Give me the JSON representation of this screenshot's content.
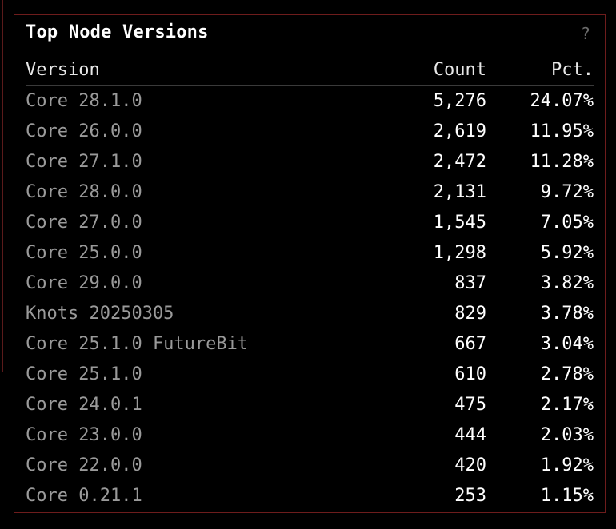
{
  "panel": {
    "title": "Top Node Versions",
    "help_label": "?",
    "help_icon": "question-icon",
    "border_color": "#6e1c1c"
  },
  "table": {
    "headers": {
      "version": "Version",
      "count": "Count",
      "pct": "Pct."
    },
    "rows": [
      {
        "version": "Core 28.1.0",
        "count": "5,276",
        "pct": "24.07%"
      },
      {
        "version": "Core 26.0.0",
        "count": "2,619",
        "pct": "11.95%"
      },
      {
        "version": "Core 27.1.0",
        "count": "2,472",
        "pct": "11.28%"
      },
      {
        "version": "Core 28.0.0",
        "count": "2,131",
        "pct": "9.72%"
      },
      {
        "version": "Core 27.0.0",
        "count": "1,545",
        "pct": "7.05%"
      },
      {
        "version": "Core 25.0.0",
        "count": "1,298",
        "pct": "5.92%"
      },
      {
        "version": "Core 29.0.0",
        "count": "837",
        "pct": "3.82%"
      },
      {
        "version": "Knots 20250305",
        "count": "829",
        "pct": "3.78%"
      },
      {
        "version": "Core 25.1.0 FutureBit",
        "count": "667",
        "pct": "3.04%"
      },
      {
        "version": "Core 25.1.0",
        "count": "610",
        "pct": "2.78%"
      },
      {
        "version": "Core 24.0.1",
        "count": "475",
        "pct": "2.17%"
      },
      {
        "version": "Core 23.0.0",
        "count": "444",
        "pct": "2.03%"
      },
      {
        "version": "Core 22.0.0",
        "count": "420",
        "pct": "1.92%"
      },
      {
        "version": "Core 0.21.1",
        "count": "253",
        "pct": "1.15%"
      }
    ]
  }
}
